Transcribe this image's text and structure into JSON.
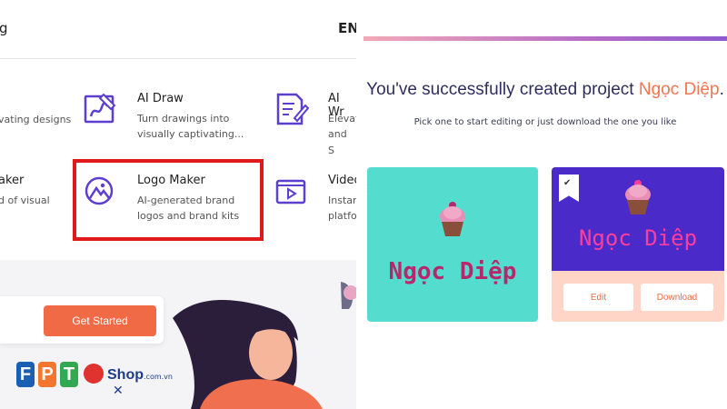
{
  "left": {
    "topbar": {
      "partial_label": "g",
      "language": "EN"
    },
    "menu": {
      "partial_left_1": {
        "desc": "vating designs"
      },
      "ai_draw": {
        "title": "AI Draw",
        "desc_line1": "Turn drawings into",
        "desc_line2": "visually captivating..."
      },
      "partial_right_1": {
        "title": "AI Wr",
        "desc_line1": "Elevat",
        "desc_line2": "and S"
      },
      "partial_left_2": {
        "title": "aker",
        "desc": "d of visual"
      },
      "logo_maker": {
        "title": "Logo Maker",
        "desc_line1": "AI-generated brand",
        "desc_line2": "logos and brand kits"
      },
      "partial_right_2": {
        "title": "Video",
        "desc_line1": "Instan",
        "desc_line2": "platfo"
      }
    },
    "cta": {
      "label": "Get Started"
    },
    "watermark_logo": {
      "letters": [
        "F",
        "P",
        "T"
      ],
      "shop": "Shop",
      "domain": ".com.vn"
    },
    "colors": {
      "accent": "#f06b45",
      "highlight": "#e01a1a",
      "icon": "#5b3fd0"
    }
  },
  "right": {
    "headline_prefix": "You've successfully created project ",
    "project_name": "Ngọc Diệp",
    "headline_suffix": ".",
    "subline": "Pick one to start editing or just download the one you like",
    "cards": [
      {
        "name": "Ngọc Diệp",
        "background": "#54dccf"
      },
      {
        "name": "Ngọc Diệp",
        "background": "#4a2bc9",
        "selected": true
      }
    ],
    "buttons": {
      "edit": "Edit",
      "download": "Download"
    },
    "colors": {
      "accent": "#f37550",
      "title": "#2f2d5e"
    }
  }
}
